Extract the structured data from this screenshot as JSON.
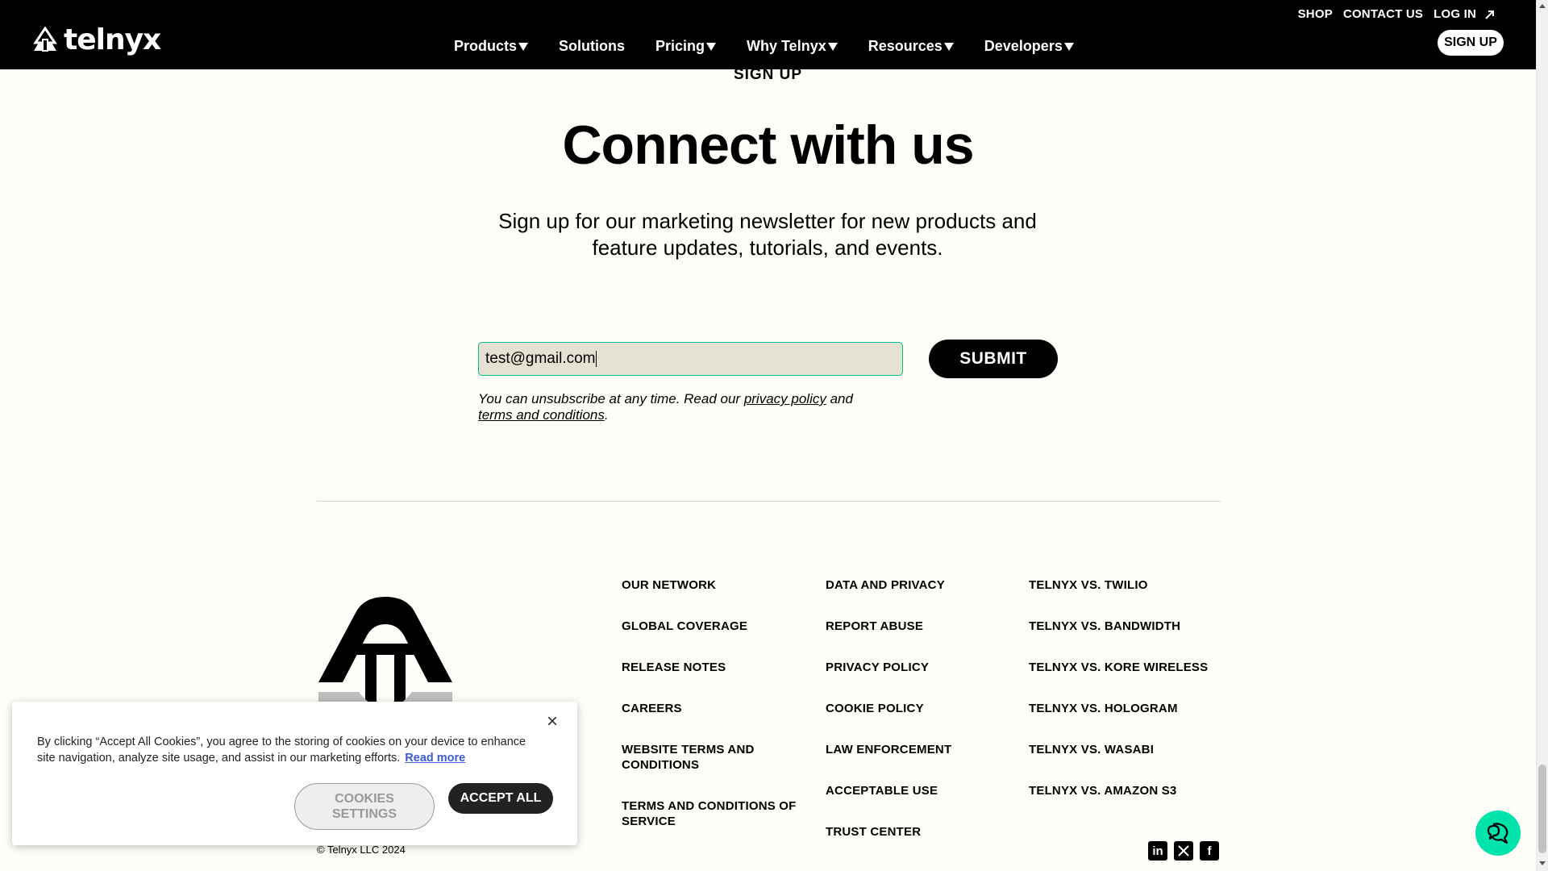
{
  "header": {
    "logo_text": "telnyx",
    "top_links": [
      "SHOP",
      "CONTACT US"
    ],
    "login": "LOG IN",
    "nav": [
      {
        "label": "Products",
        "has_caret": true
      },
      {
        "label": "Solutions",
        "has_caret": false
      },
      {
        "label": "Pricing",
        "has_caret": true
      },
      {
        "label": "Why Telnyx",
        "has_caret": true
      },
      {
        "label": "Resources",
        "has_caret": true
      },
      {
        "label": "Developers",
        "has_caret": true
      }
    ],
    "signup": "SIGN UP"
  },
  "signup_section": {
    "eyebrow": "SIGN UP",
    "headline": "Connect with us",
    "subhead": "Sign up for our marketing newsletter for new products and feature updates, tutorials, and events.",
    "email_value": "test@gmail.com",
    "submit": "SUBMIT",
    "disclaimer_prefix": "You can unsubscribe at any time. Read our ",
    "privacy_link": "privacy policy",
    "disclaimer_mid": " and ",
    "terms_link": "terms and conditions",
    "disclaimer_suffix": "."
  },
  "footer": {
    "col1": [
      "OUR NETWORK",
      "GLOBAL COVERAGE",
      "RELEASE NOTES",
      "CAREERS",
      "WEBSITE TERMS AND CONDITIONS",
      "TERMS AND CONDITIONS OF SERVICE"
    ],
    "col2": [
      "DATA AND PRIVACY",
      "REPORT ABUSE",
      "PRIVACY POLICY",
      "COOKIE POLICY",
      "LAW ENFORCEMENT",
      "ACCEPTABLE USE",
      "TRUST CENTER"
    ],
    "col3": [
      "TELNYX VS. TWILIO",
      "TELNYX VS. BANDWIDTH",
      "TELNYX VS. KORE WIRELESS",
      "TELNYX VS. HOLOGRAM",
      "TELNYX VS. WASABI",
      "TELNYX VS. AMAZON S3"
    ],
    "copyright": "© Telnyx LLC 2024",
    "social": [
      "linkedin-icon",
      "x-icon",
      "facebook-icon"
    ]
  },
  "cookie_banner": {
    "text": "By clicking “Accept All Cookies”, you agree to the storing of cookies on your device to enhance site navigation, analyze site usage, and assist in our marketing efforts.",
    "read_more": "Read more",
    "settings": "COOKIES SETTINGS",
    "accept": "ACCEPT ALL"
  },
  "colors": {
    "accent": "#00e3aa",
    "input_border": "#00c08b",
    "background": "#fefdf8",
    "header_bg": "#000000"
  }
}
